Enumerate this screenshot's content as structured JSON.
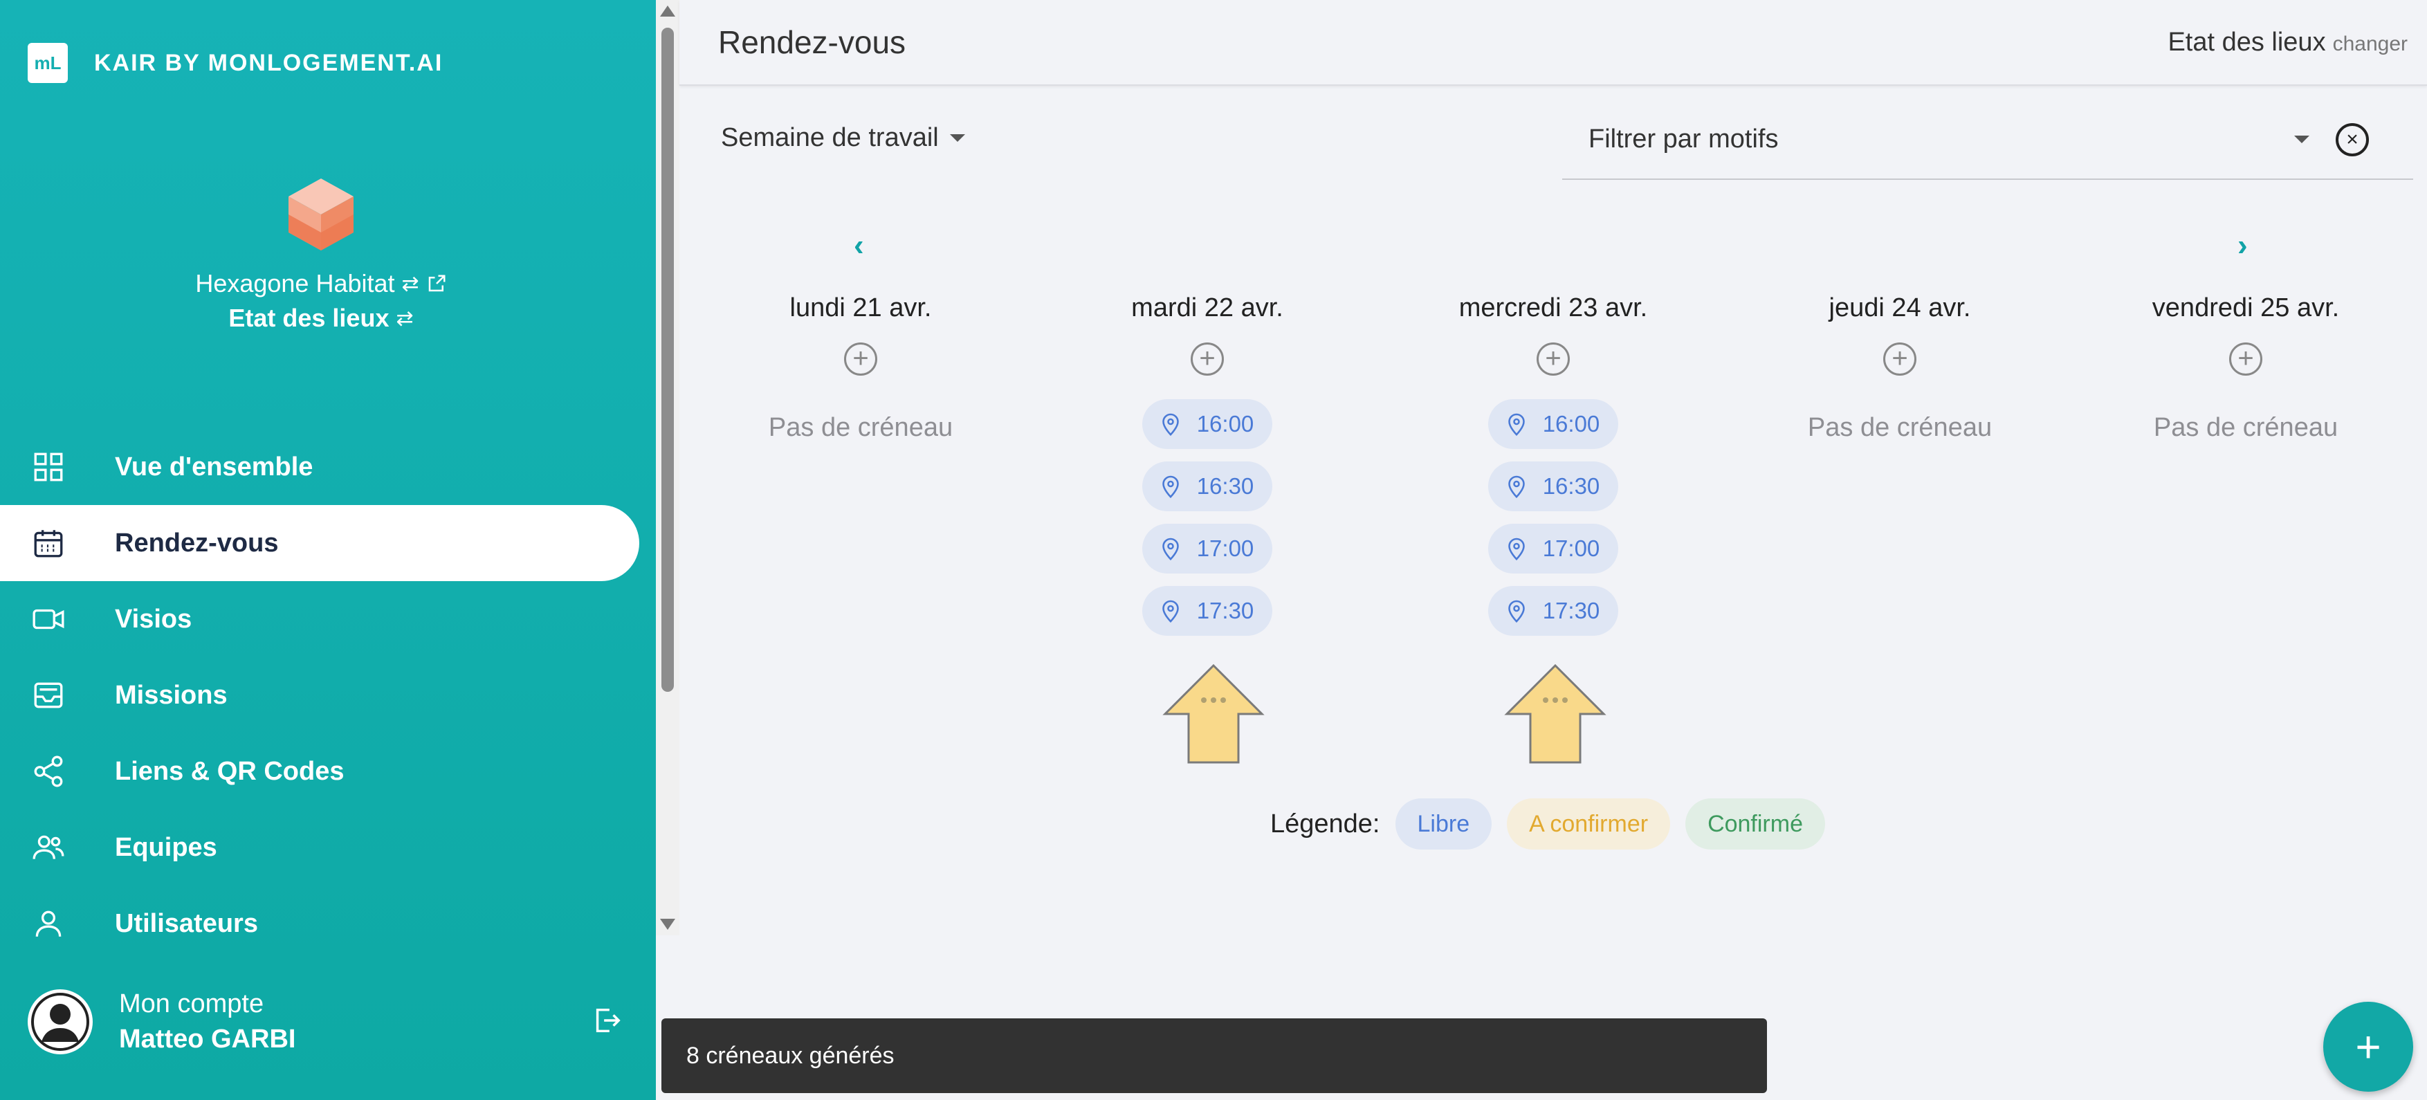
{
  "app": {
    "brand_logo": "mL",
    "brand_name": "KAIR BY MONLOGEMENT.AI"
  },
  "organization": {
    "name": "Hexagone Habitat",
    "context": "Etat des lieux",
    "icons": [
      "swap-icon",
      "external-link-icon"
    ]
  },
  "sidebar": {
    "items": [
      {
        "label": "Vue d'ensemble",
        "icon": "grid-icon",
        "active": false
      },
      {
        "label": "Rendez-vous",
        "icon": "calendar-icon",
        "active": true
      },
      {
        "label": "Visios",
        "icon": "video-icon",
        "active": false
      },
      {
        "label": "Missions",
        "icon": "inbox-icon",
        "active": false
      },
      {
        "label": "Liens & QR Codes",
        "icon": "share-icon",
        "active": false
      },
      {
        "label": "Equipes",
        "icon": "team-icon",
        "active": false
      },
      {
        "label": "Utilisateurs",
        "icon": "user-icon",
        "active": false
      }
    ],
    "account": {
      "label": "Mon compte",
      "user_name": "Matteo GARBI"
    }
  },
  "header": {
    "title": "Rendez-vous",
    "context": "Etat des lieux",
    "change_link": "changer"
  },
  "toolbar": {
    "week_select": "Semaine de travail",
    "filter_label": "Filtrer par motifs"
  },
  "calendar": {
    "prev_label": "‹",
    "next_label": "›",
    "no_slot_text": "Pas de créneau",
    "days": [
      {
        "label": "lundi 21 avr.",
        "slots": []
      },
      {
        "label": "mardi 22 avr.",
        "slots": [
          "16:00",
          "16:30",
          "17:00",
          "17:30"
        ]
      },
      {
        "label": "mercredi 23 avr.",
        "slots": [
          "16:00",
          "16:30",
          "17:00",
          "17:30"
        ]
      },
      {
        "label": "jeudi 24 avr.",
        "slots": []
      },
      {
        "label": "vendredi 25 avr.",
        "slots": []
      }
    ]
  },
  "legend": {
    "title": "Légende:",
    "items": [
      {
        "label": "Libre",
        "color": "#4a7ad6"
      },
      {
        "label": "A confirmer",
        "color": "#e2a92f"
      },
      {
        "label": "Confirmé",
        "color": "#3e9a5e"
      }
    ]
  },
  "snackbar": {
    "message": "8 créneaux générés"
  },
  "fab": {
    "label": "+"
  },
  "colors": {
    "sidebar": "#12aeb0",
    "accent": "#12a8a6",
    "slot_bg": "#dfe6f4",
    "slot_text": "#4a7ad6"
  }
}
